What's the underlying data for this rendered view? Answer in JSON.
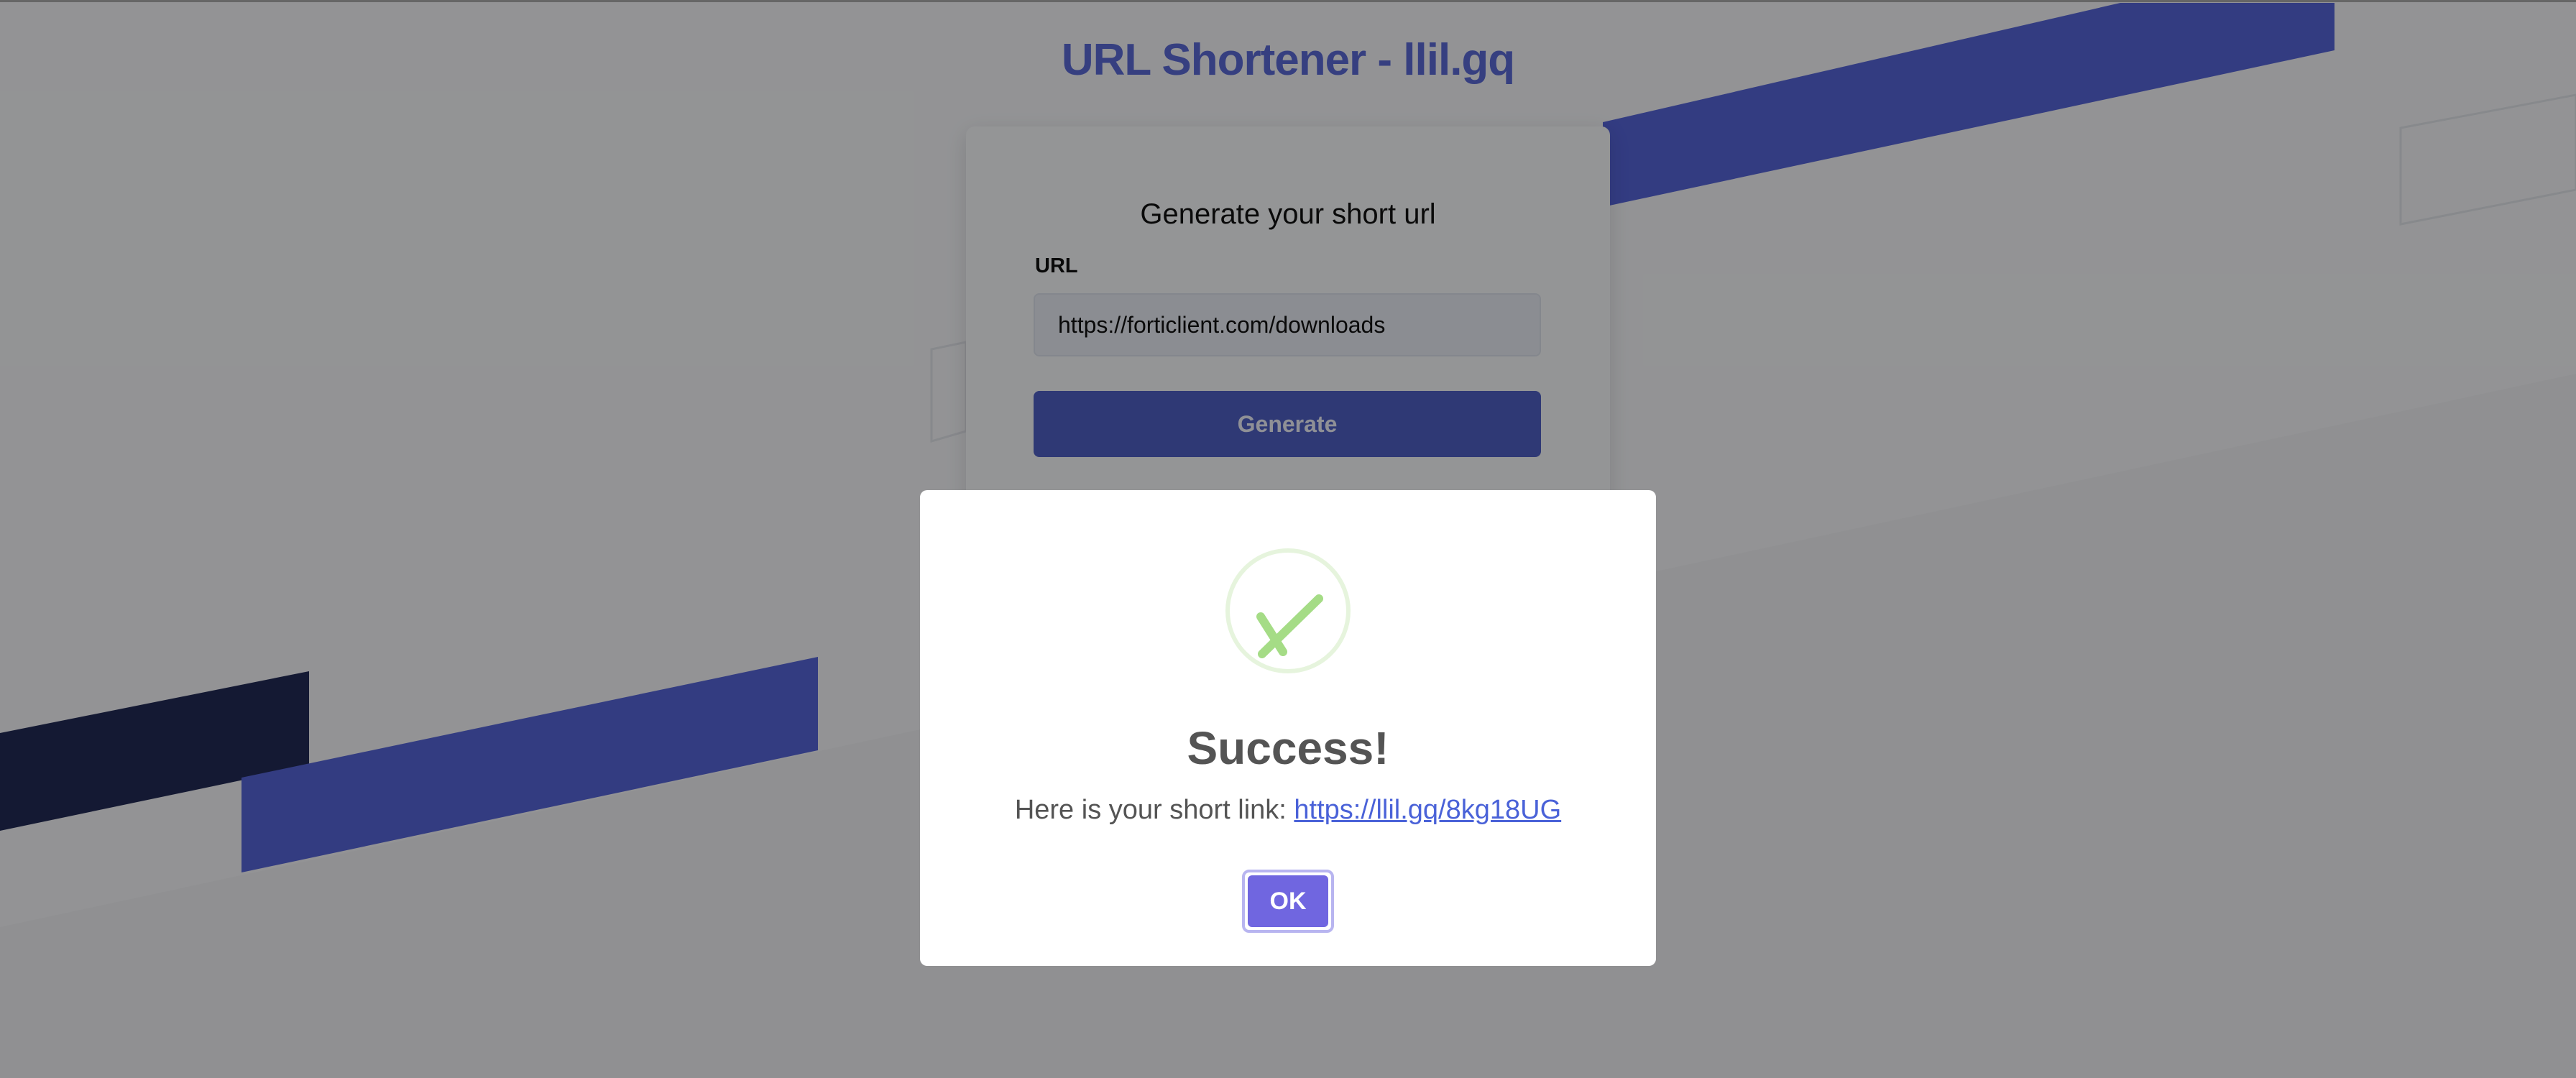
{
  "page": {
    "title": "URL Shortener - llil.gq"
  },
  "form": {
    "heading": "Generate your short url",
    "url_label": "URL",
    "url_value": "https://forticlient.com/downloads",
    "generate_label": "Generate"
  },
  "dialog": {
    "title": "Success!",
    "message_prefix": "Here is your short link: ",
    "short_link": "https://llil.gq/8kg18UG",
    "ok_label": "OK"
  },
  "colors": {
    "accent": "#5a6ad6",
    "shape_blue": "#5564d8",
    "shape_navy": "#222a55",
    "success_green": "#a5dc86",
    "ok_button": "#7066e0",
    "link": "#4a62d8"
  },
  "icons": {
    "success": "checkmark-circle-icon"
  }
}
